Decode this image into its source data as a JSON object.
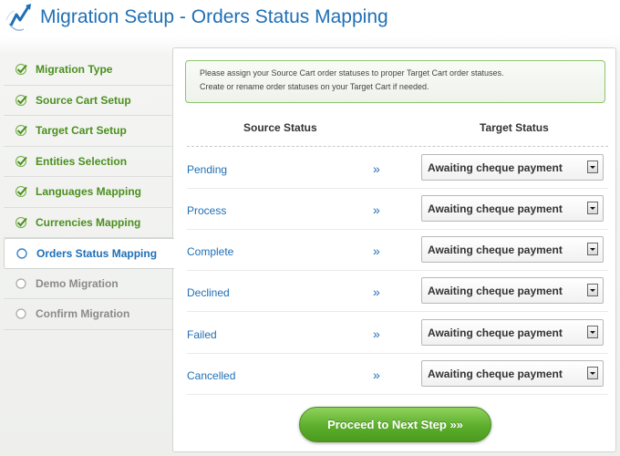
{
  "header": {
    "title": "Migration Setup - Orders Status Mapping",
    "logo_icon": "arrow-logo-icon"
  },
  "sidebar": {
    "steps": [
      {
        "label": "Migration Type",
        "state": "done"
      },
      {
        "label": "Source Cart Setup",
        "state": "done"
      },
      {
        "label": "Target Cart Setup",
        "state": "done"
      },
      {
        "label": "Entities Selection",
        "state": "done"
      },
      {
        "label": "Languages Mapping",
        "state": "done"
      },
      {
        "label": "Currencies Mapping",
        "state": "done"
      },
      {
        "label": "Orders Status Mapping",
        "state": "current"
      },
      {
        "label": "Demo Migration",
        "state": "pending"
      },
      {
        "label": "Confirm Migration",
        "state": "pending"
      }
    ]
  },
  "main": {
    "notice_line1": "Please assign your Source Cart order statuses to proper Target Cart order statuses.",
    "notice_line2": "Create or rename order statuses on your Target Cart if needed.",
    "source_header": "Source Status",
    "target_header": "Target Status",
    "arrow_symbol": "»",
    "rows": [
      {
        "source": "Pending",
        "target": "Awaiting cheque payment"
      },
      {
        "source": "Process",
        "target": "Awaiting cheque payment"
      },
      {
        "source": "Complete",
        "target": "Awaiting cheque payment"
      },
      {
        "source": "Declined",
        "target": "Awaiting cheque payment"
      },
      {
        "source": "Failed",
        "target": "Awaiting cheque payment"
      },
      {
        "source": "Cancelled",
        "target": "Awaiting cheque payment"
      }
    ],
    "proceed_label": "Proceed to Next Step »»"
  },
  "colors": {
    "title_blue": "#1f6fb6",
    "done_green": "#4b8f1e",
    "pending_gray": "#8a8a8a",
    "button_green": "#5cae2c"
  }
}
